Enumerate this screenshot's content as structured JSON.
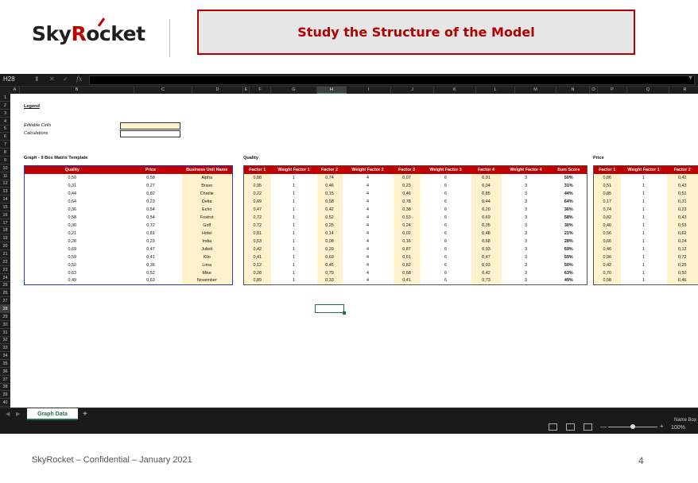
{
  "brand": {
    "logo_text_a": "Sky",
    "logo_text_b": "R",
    "logo_text_c": "ocket"
  },
  "title": "Study the Structure of the Model",
  "formula_bar": {
    "cell_ref": "H28",
    "fx": "fx",
    "value": ""
  },
  "columns": [
    "A",
    "B",
    "C",
    "D",
    "E",
    "F",
    "G",
    "H",
    "I",
    "J",
    "K",
    "L",
    "M",
    "N",
    "O",
    "P",
    "Q",
    "R"
  ],
  "rows": [
    "1",
    "2",
    "3",
    "4",
    "5",
    "6",
    "7",
    "8",
    "9",
    "10",
    "11",
    "12",
    "13",
    "14",
    "15",
    "16",
    "17",
    "18",
    "19",
    "20",
    "21",
    "22",
    "23",
    "24",
    "25",
    "26",
    "27",
    "28",
    "29",
    "30",
    "31",
    "32",
    "33",
    "34",
    "35",
    "36",
    "37",
    "38",
    "39",
    "40"
  ],
  "legend": {
    "heading": "Legend",
    "editable": "Editable Cells",
    "calculations": "Calculations"
  },
  "section_titles": {
    "graph": "Graph - 9 Box Matrix Template",
    "quality": "Quality",
    "price": "Price"
  },
  "graph_table": {
    "headers": [
      "Quality",
      "Price",
      "Business Unit Name"
    ],
    "rows": [
      [
        "0,50",
        "0,58",
        "Alpha"
      ],
      [
        "0,31",
        "0,27",
        "Bravo"
      ],
      [
        "0,44",
        "0,82",
        "Charlie"
      ],
      [
        "0,64",
        "0,23",
        "Delta"
      ],
      [
        "0,36",
        "0,54",
        "Echo"
      ],
      [
        "0,58",
        "0,54",
        "Foxtrot"
      ],
      [
        "0,30",
        "0,72",
        "Golf"
      ],
      [
        "0,21",
        "0,81",
        "Hotel"
      ],
      [
        "0,28",
        "0,23",
        "India"
      ],
      [
        "0,69",
        "0,47",
        "Juliett"
      ],
      [
        "0,59",
        "0,41",
        "Kilo"
      ],
      [
        "0,50",
        "0,36",
        "Lima"
      ],
      [
        "0,63",
        "0,52",
        "Mike"
      ],
      [
        "0,49",
        "0,63",
        "November"
      ]
    ]
  },
  "quality_table": {
    "headers": [
      "Factor 1",
      "Weight Factor 1",
      "Factor 2",
      "Weight Factor 2",
      "Factor 3",
      "Weight Factor 3",
      "Factor 4",
      "Weight Factor 4",
      "Sum Score"
    ],
    "rows": [
      [
        "0,88",
        "1",
        "0,74",
        "4",
        "0,07",
        "6",
        "0,91",
        "3",
        "50%"
      ],
      [
        "0,95",
        "1",
        "0,46",
        "4",
        "0,23",
        "6",
        "0,04",
        "3",
        "31%"
      ],
      [
        "0,22",
        "1",
        "0,15",
        "4",
        "0,46",
        "6",
        "0,85",
        "3",
        "44%"
      ],
      [
        "0,69",
        "1",
        "0,58",
        "4",
        "0,78",
        "6",
        "0,44",
        "3",
        "64%"
      ],
      [
        "0,47",
        "1",
        "0,42",
        "4",
        "0,38",
        "6",
        "0,20",
        "3",
        "36%"
      ],
      [
        "0,72",
        "1",
        "0,52",
        "4",
        "0,53",
        "6",
        "0,69",
        "3",
        "58%"
      ],
      [
        "0,72",
        "1",
        "0,25",
        "4",
        "0,24",
        "6",
        "0,35",
        "3",
        "30%"
      ],
      [
        "0,81",
        "1",
        "0,14",
        "4",
        "0,02",
        "6",
        "0,48",
        "3",
        "21%"
      ],
      [
        "0,53",
        "1",
        "0,08",
        "4",
        "0,16",
        "6",
        "0,68",
        "3",
        "28%"
      ],
      [
        "0,42",
        "1",
        "0,29",
        "4",
        "0,87",
        "6",
        "0,93",
        "3",
        "69%"
      ],
      [
        "0,41",
        "1",
        "0,69",
        "4",
        "0,61",
        "6",
        "0,47",
        "3",
        "59%"
      ],
      [
        "0,12",
        "1",
        "0,45",
        "4",
        "0,82",
        "6",
        "0,03",
        "3",
        "50%"
      ],
      [
        "0,28",
        "1",
        "0,79",
        "4",
        "0,68",
        "6",
        "0,42",
        "3",
        "63%"
      ],
      [
        "0,89",
        "1",
        "0,33",
        "4",
        "0,41",
        "6",
        "0,73",
        "3",
        "49%"
      ]
    ]
  },
  "price_table": {
    "headers": [
      "Factor 1",
      "Weight Factor 1",
      "Factor 2"
    ],
    "rows": [
      [
        "0,86",
        "1",
        "0,42"
      ],
      [
        "0,51",
        "1",
        "0,43"
      ],
      [
        "0,85",
        "1",
        "0,51"
      ],
      [
        "0,17",
        "1",
        "0,31"
      ],
      [
        "0,74",
        "1",
        "0,23"
      ],
      [
        "0,82",
        "1",
        "0,43"
      ],
      [
        "0,40",
        "1",
        "0,53"
      ],
      [
        "0,56",
        "1",
        "0,62"
      ],
      [
        "0,66",
        "1",
        "0,24"
      ],
      [
        "0,46",
        "1",
        "0,12"
      ],
      [
        "0,96",
        "1",
        "0,72"
      ],
      [
        "0,42",
        "1",
        "0,25"
      ],
      [
        "0,70",
        "1",
        "0,50"
      ],
      [
        "0,58",
        "1",
        "0,46"
      ]
    ]
  },
  "sheet_tab": "Graph Data",
  "add_tab": "+",
  "status": {
    "name_box_label": "Name Box",
    "zoom": "100%",
    "minus": "—",
    "plus": "+"
  },
  "footer": "SkyRocket – Confidential – January 2021",
  "page_number": "4"
}
